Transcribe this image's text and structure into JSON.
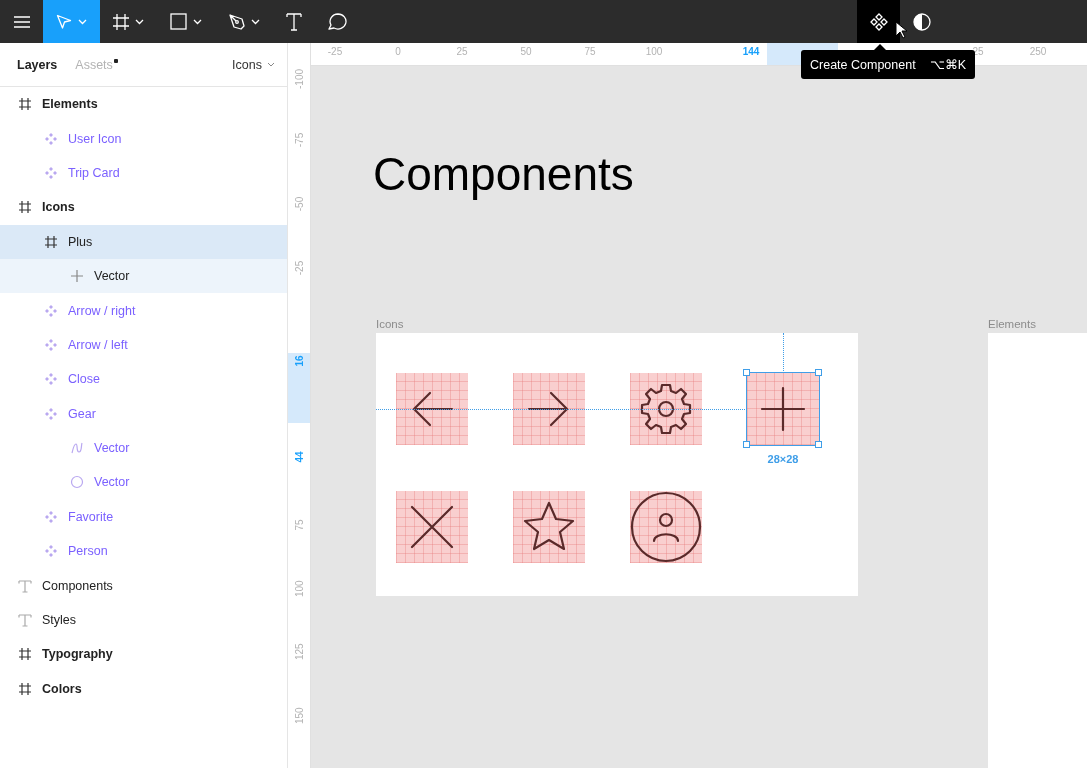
{
  "toolbar": {
    "tools": [
      {
        "kind": "menu",
        "selected": false,
        "dropdown": false
      },
      {
        "kind": "move",
        "selected": true,
        "dropdown": true
      },
      {
        "kind": "frame",
        "selected": false,
        "dropdown": true
      },
      {
        "kind": "rectangle",
        "selected": false,
        "dropdown": true
      },
      {
        "kind": "pen",
        "selected": false,
        "dropdown": true
      },
      {
        "kind": "text",
        "selected": false,
        "dropdown": false
      },
      {
        "kind": "comment",
        "selected": false,
        "dropdown": false
      }
    ],
    "actions": [
      {
        "kind": "component",
        "selected": true
      },
      {
        "kind": "contrast",
        "selected": false
      }
    ],
    "tooltip": {
      "label": "Create Component",
      "shortcut": "⌥⌘K"
    }
  },
  "panel": {
    "tabs": [
      {
        "label": "Layers",
        "selected": true,
        "badge": false
      },
      {
        "label": "Assets",
        "selected": false,
        "badge": true
      }
    ],
    "page_selector": "Icons",
    "layers": [
      {
        "name": "Elements",
        "kind": "frame",
        "selected": false,
        "children": [
          {
            "name": "User Icon",
            "kind": "component",
            "selected": false
          },
          {
            "name": "Trip Card",
            "kind": "component",
            "selected": false
          }
        ]
      },
      {
        "name": "Icons",
        "kind": "frame",
        "selected": false,
        "children": [
          {
            "name": "Plus",
            "kind": "frame",
            "selected": true,
            "children": [
              {
                "name": "Vector",
                "kind": "plus",
                "selected": false
              }
            ]
          },
          {
            "name": "Arrow / right",
            "kind": "component",
            "selected": false
          },
          {
            "name": "Arrow / left",
            "kind": "component",
            "selected": false
          },
          {
            "name": "Close",
            "kind": "component",
            "selected": false
          },
          {
            "name": "Gear",
            "kind": "component",
            "selected": false,
            "children": [
              {
                "name": "Vector",
                "kind": "path",
                "selected": false
              },
              {
                "name": "Vector",
                "kind": "ellipse",
                "selected": false
              }
            ]
          },
          {
            "name": "Favorite",
            "kind": "component",
            "selected": false
          },
          {
            "name": "Person",
            "kind": "component",
            "selected": false
          }
        ]
      },
      {
        "name": "Components",
        "kind": "text",
        "selected": false
      },
      {
        "name": "Styles",
        "kind": "text",
        "selected": false
      },
      {
        "name": "Typography",
        "kind": "frame",
        "selected": false
      },
      {
        "name": "Colors",
        "kind": "frame",
        "selected": false
      }
    ]
  },
  "canvas": {
    "ruler_x": [
      {
        "label": "-25",
        "highlighted": false
      },
      {
        "label": "0",
        "highlighted": false
      },
      {
        "label": "25",
        "highlighted": false
      },
      {
        "label": "50",
        "highlighted": false
      },
      {
        "label": "75",
        "highlighted": false
      },
      {
        "label": "100",
        "highlighted": false
      },
      {
        "label": "144",
        "highlighted": true
      },
      {
        "label": "25",
        "highlighted": false
      },
      {
        "label": "250",
        "highlighted": false
      }
    ],
    "ruler_y": [
      {
        "label": "-100",
        "highlighted": false
      },
      {
        "label": "-75",
        "highlighted": false
      },
      {
        "label": "-50",
        "highlighted": false
      },
      {
        "label": "-25",
        "highlighted": false
      },
      {
        "label": "16",
        "highlighted": true
      },
      {
        "label": "44",
        "highlighted": true
      },
      {
        "label": "75",
        "highlighted": false
      },
      {
        "label": "100",
        "highlighted": false
      },
      {
        "label": "125",
        "highlighted": false
      },
      {
        "label": "150",
        "highlighted": false
      }
    ],
    "heading": "Components",
    "frames": [
      {
        "label": "Icons",
        "icons": [
          {
            "kind": "arrow-left",
            "selected": false
          },
          {
            "kind": "arrow-right",
            "selected": false
          },
          {
            "kind": "gear",
            "selected": false
          },
          {
            "kind": "plus",
            "selected": true
          },
          {
            "kind": "close",
            "selected": false
          },
          {
            "kind": "star",
            "selected": false
          },
          {
            "kind": "person",
            "selected": false
          }
        ]
      },
      {
        "label": "Elements"
      }
    ],
    "selection_size": "28×28"
  }
}
